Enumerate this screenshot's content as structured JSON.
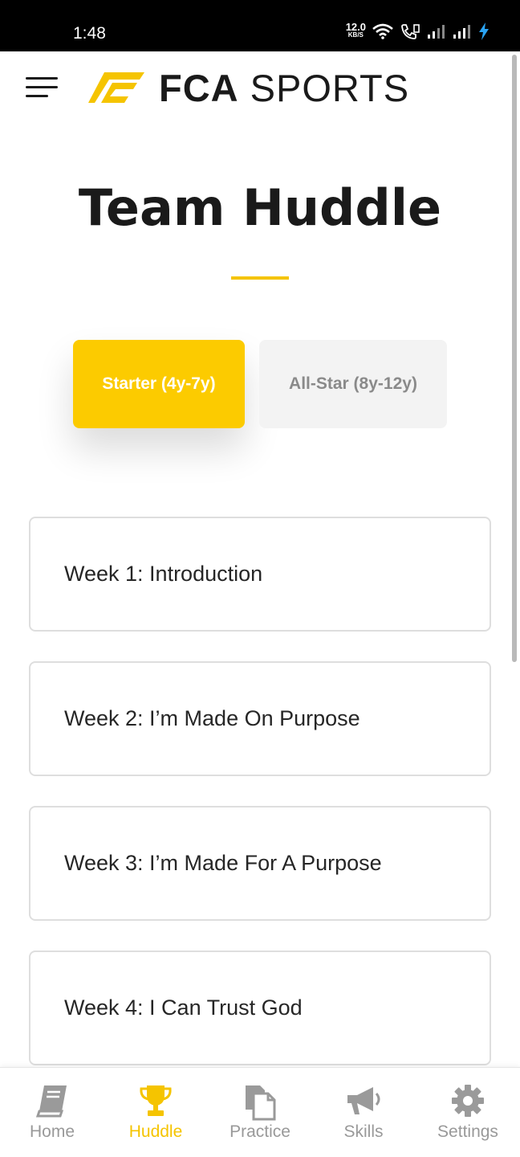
{
  "status_bar": {
    "time": "1:48",
    "net_speed_value": "12.0",
    "net_speed_unit": "KB/S",
    "icons": [
      "wifi-icon",
      "volte-icon",
      "signal-icon",
      "signal-icon",
      "charging-bolt-icon"
    ]
  },
  "header": {
    "logo_bold": "FCA",
    "logo_light": "SPORTS",
    "brand_color": "#f5c400"
  },
  "page": {
    "title": "Team Huddle"
  },
  "tabs": [
    {
      "label": "Starter (4y-7y)",
      "active": true
    },
    {
      "label": "All-Star (8y-12y)",
      "active": false
    }
  ],
  "weeks": [
    {
      "label": "Week 1: Introduction"
    },
    {
      "label": "Week 2: I’m Made On Purpose"
    },
    {
      "label": "Week 3: I’m Made For A Purpose"
    },
    {
      "label": "Week 4: I Can Trust God"
    }
  ],
  "bottom_nav": [
    {
      "label": "Home",
      "icon": "book-icon",
      "active": false
    },
    {
      "label": "Huddle",
      "icon": "trophy-icon",
      "active": true
    },
    {
      "label": "Practice",
      "icon": "documents-icon",
      "active": false
    },
    {
      "label": "Skills",
      "icon": "megaphone-icon",
      "active": false
    },
    {
      "label": "Settings",
      "icon": "gear-icon",
      "active": false
    }
  ],
  "colors": {
    "accent": "#fccb00",
    "nav_inactive": "#999999",
    "nav_active": "#f5c400"
  }
}
